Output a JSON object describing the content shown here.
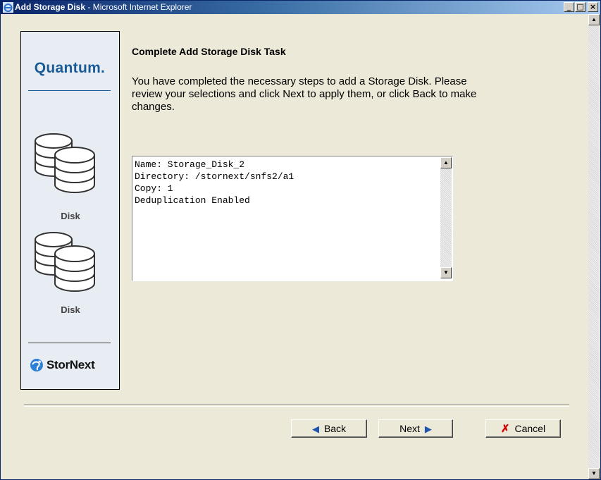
{
  "window": {
    "title_page": "Add Storage Disk",
    "title_app": " - Microsoft Internet Explorer",
    "minimize": "_",
    "maximize": "□",
    "close": "×"
  },
  "sidebar": {
    "logo": "Quantum.",
    "disk_label_1": "Disk",
    "disk_label_2": "Disk",
    "brand": "StorNext"
  },
  "main": {
    "heading": "Complete Add Storage Disk Task",
    "description": "You have completed the necessary steps to add a Storage Disk. Please review your selections and click Next to apply them, or click Back to make changes.",
    "summary_text": "Name: Storage_Disk_2\nDirectory: /stornext/snfs2/a1\nCopy: 1\nDeduplication Enabled"
  },
  "buttons": {
    "back": "Back",
    "next": "Next",
    "cancel": "Cancel"
  },
  "colors": {
    "accent": "#1a5b97",
    "cancel_icon": "#d00000"
  }
}
